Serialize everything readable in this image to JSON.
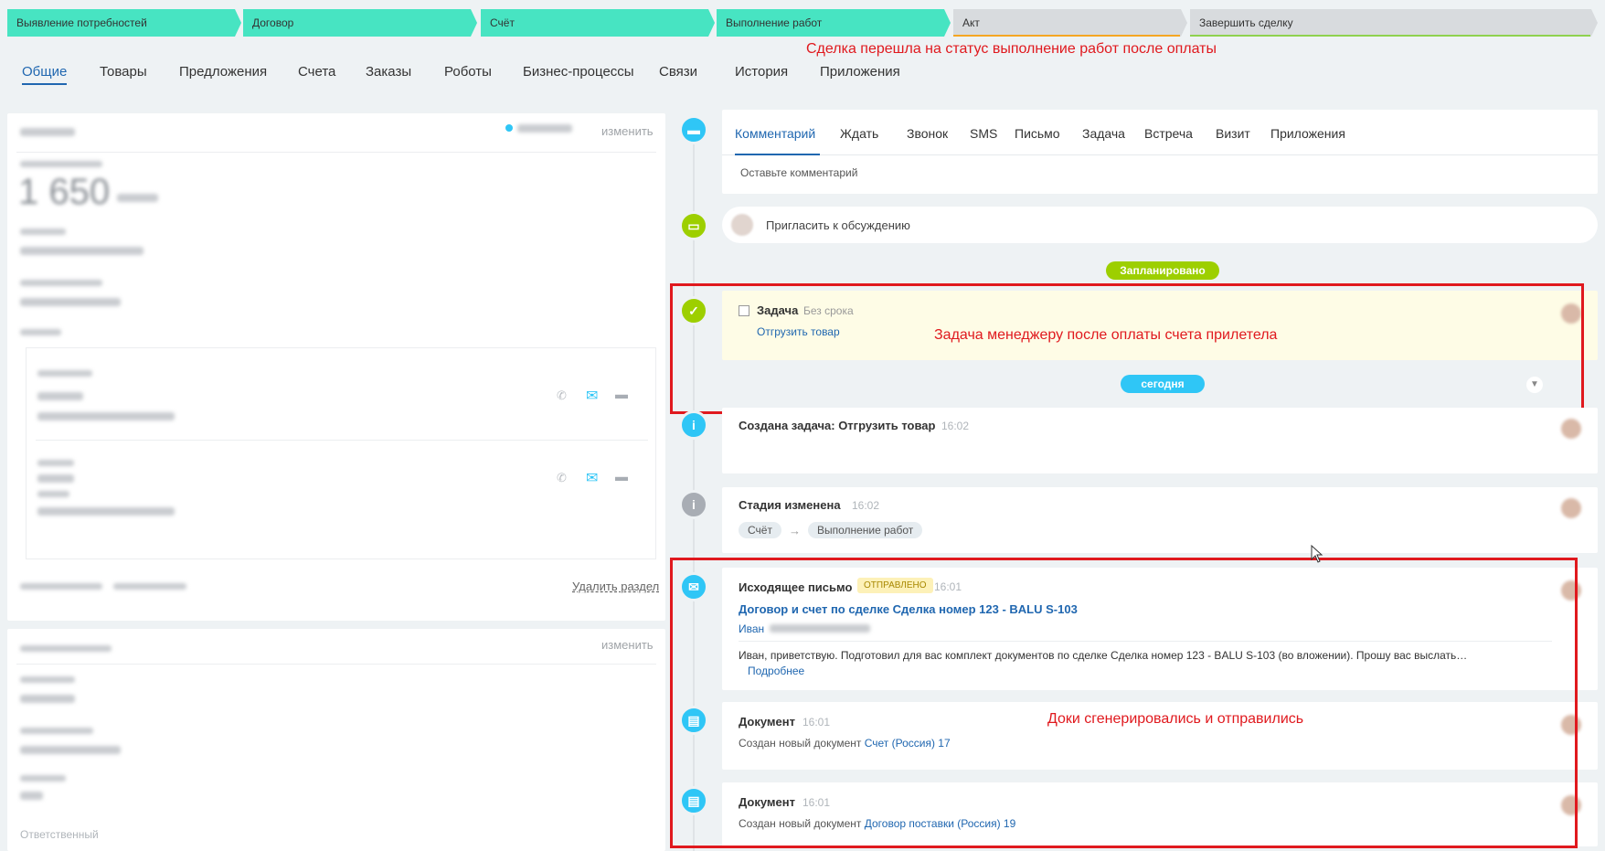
{
  "stages": [
    {
      "label": "Выявление потребностей",
      "state": "done"
    },
    {
      "label": "Договор",
      "state": "done"
    },
    {
      "label": "Счёт",
      "state": "done"
    },
    {
      "label": "Выполнение работ",
      "state": "done"
    },
    {
      "label": "Акт",
      "state": "todo",
      "bar_color": "#f5a623"
    },
    {
      "label": "Завершить сделку",
      "state": "todo",
      "bar_color": "#8fd14f"
    }
  ],
  "annotations": {
    "stage_note": "Сделка перешла на статус выполнение работ после оплаты",
    "task_note": "Задача менеджеру после оплаты счета прилетела",
    "docs_note": "Доки сгенерировались и отправились"
  },
  "tabs": [
    "Общие",
    "Товары",
    "Предложения",
    "Счета",
    "Заказы",
    "Роботы",
    "Бизнес-процессы",
    "Связи",
    "История",
    "Приложения"
  ],
  "left": {
    "change": "изменить",
    "amount": "1 650",
    "delete_section": "Удалить раздел",
    "change2": "изменить",
    "responsible_label": "Ответственный"
  },
  "activity_tabs": [
    "Комментарий",
    "Ждать",
    "Звонок",
    "SMS",
    "Письмо",
    "Задача",
    "Встреча",
    "Визит",
    "Приложения"
  ],
  "comment_placeholder": "Оставьте комментарий",
  "invite": "Пригласить к обсуждению",
  "planned_badge": "Запланировано",
  "today_badge": "сегодня",
  "task": {
    "title": "Задача",
    "deadline": "Без срока",
    "link": "Отгрузить товар"
  },
  "events": {
    "created_task": {
      "title": "Создана задача: Отгрузить товар",
      "time": "16:02"
    },
    "stage_changed": {
      "title": "Стадия изменена",
      "time": "16:02",
      "from": "Счёт",
      "arrow": "→",
      "to": "Выполнение работ"
    },
    "email": {
      "title": "Исходящее письмо",
      "status": "ОТПРАВЛЕНО",
      "time": "16:01",
      "subject": "Договор и счет по сделке Сделка номер 123 - BALU S-103",
      "to_name": "Иван",
      "body": "Иван, приветствую. Подготовил для вас комплект документов по сделке Сделка номер 123 - BALU S-103 (во вложении). Прошу вас выслать…",
      "more": "Подробнее"
    },
    "doc1": {
      "title": "Документ",
      "time": "16:01",
      "text": "Создан новый документ",
      "link": "Счет (Россия) 17"
    },
    "doc2": {
      "title": "Документ",
      "time": "16:01",
      "text": "Создан новый документ",
      "link": "Договор поставки (Россия) 19"
    }
  },
  "colors": {
    "stage_done": "#47e4c2",
    "stage_todo": "#d8dbde",
    "accent": "#2067b0",
    "icon_blue": "#2fc6f6",
    "icon_green": "#9dcf00",
    "icon_gray": "#a8adb4",
    "annotation_red": "#e0191e"
  }
}
